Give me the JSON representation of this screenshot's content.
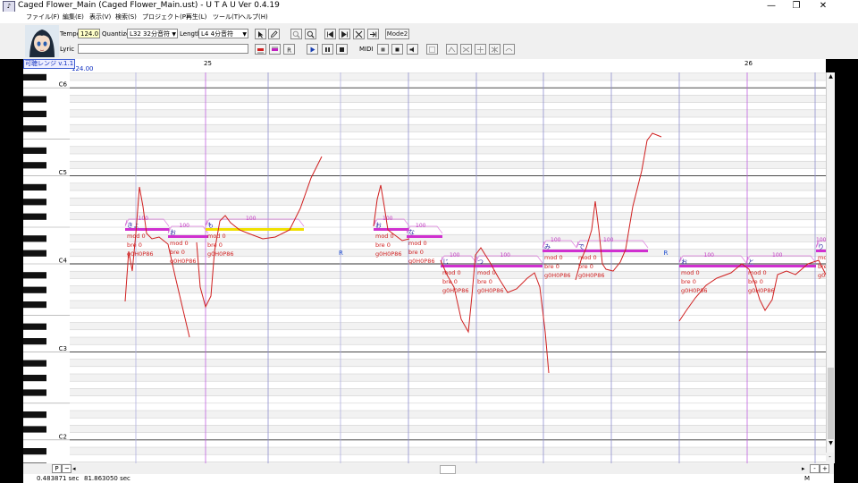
{
  "window": {
    "title": "Caged Flower_Main (Caged Flower_Main.ust) - U T A U Ver 0.4.19",
    "minimize_glyph": "—",
    "maximize_glyph": "❐",
    "close_glyph": "✕"
  },
  "menu": [
    "ファイル(F)",
    "編集(E)",
    "表示(V)",
    "検索(S)",
    "プロジェクト(P)",
    "再生(L)",
    "ツール(T)",
    "ヘルプ(H)"
  ],
  "toolbar": {
    "tempo_label": "Tempo",
    "tempo_value": "124.0",
    "quantize_label": "Quantize",
    "quantize_value": "L32 32分音符",
    "length_label": "Length",
    "length_value": "L4 4分音符",
    "lyric_label": "Lyric",
    "lyric_value": "",
    "mode2_label": "Mode2",
    "midi_label": "MIDI"
  },
  "ruler": {
    "range_label": "可聴レンジ v.1.1",
    "tempo_marker": "124.00",
    "measures": [
      "25",
      "26"
    ]
  },
  "piano_labels": [
    "C6",
    "C5",
    "C4",
    "C3",
    "C2"
  ],
  "notes": [
    {
      "lyric": "きょ",
      "params": [
        "mod 0",
        "bre 0",
        "g0H0P86"
      ]
    },
    {
      "lyric": "お",
      "params": [
        "mod 0",
        "bre 0",
        "g0H0P86"
      ]
    },
    {
      "lyric": "も",
      "params": [
        "mod 0",
        "bre 0",
        "g0H0P86"
      ]
    },
    {
      "lyric": "R",
      "params": []
    },
    {
      "lyric": "お",
      "params": [
        "mod 0",
        "bre 0",
        "g0H0P86"
      ]
    },
    {
      "lyric": "な",
      "params": [
        "mod 0",
        "bre 0",
        "g0H0P86"
      ]
    },
    {
      "lyric": "じ",
      "params": [
        "mod 0",
        "bre 0",
        "g0H0P86"
      ]
    },
    {
      "lyric": "つ",
      "params": [
        "mod 0",
        "bre 0",
        "g0H0P86"
      ]
    },
    {
      "lyric": "み",
      "params": [
        "mod 0",
        "bre 0",
        "g0H0P86"
      ]
    },
    {
      "lyric": "で",
      "params": [
        "mod 0",
        "bre 0",
        "g0H0P86"
      ]
    },
    {
      "lyric": "R",
      "params": []
    },
    {
      "lyric": "お",
      "params": [
        "mod 0",
        "bre 0",
        "g0H0P86"
      ]
    },
    {
      "lyric": "と",
      "params": [
        "mod 0",
        "bre 0",
        "g0H0P86"
      ]
    },
    {
      "lyric": "り",
      "params": [
        "mod 0",
        "bre 0",
        "g0H0P86"
      ]
    }
  ],
  "velocity_label": "100",
  "envelope_tick": "/",
  "bottom": {
    "p_label": "P",
    "tilde_label": "~",
    "left_arrow": "◂",
    "right_arrow": "▸",
    "minus_label": "-",
    "plus_label": "+",
    "zoom_v_minus": "-",
    "zoom_v_plus": "+"
  },
  "status": {
    "time_left": "0.483871 sec",
    "time_right": "81.863050 sec",
    "mode": "M"
  }
}
